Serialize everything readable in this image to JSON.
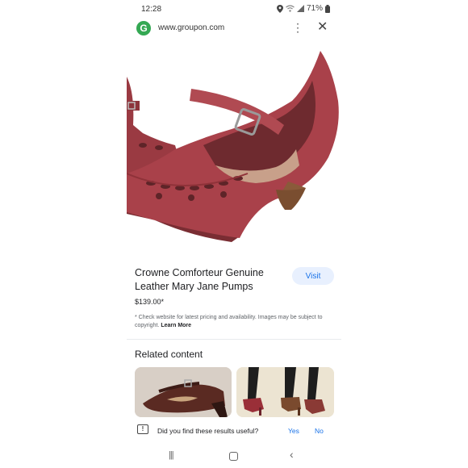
{
  "status_bar": {
    "time": "12:28",
    "battery": "71%",
    "icons": [
      "location-icon",
      "wifi-icon",
      "signal-icon",
      "battery-icon"
    ]
  },
  "browser": {
    "url": "www.groupon.com",
    "favicon_letter": "G",
    "menu_icon": "kebab-menu-icon",
    "close_icon": "close-icon"
  },
  "product": {
    "title": "Crowne Comforteur Genuine Leather Mary Jane Pumps",
    "price": "$139.00*",
    "visit_label": "Visit",
    "disclaimer_text": "* Check website for latest pricing and availability. Images may be subject to copyright.",
    "learn_more": "Learn More"
  },
  "related": {
    "heading": "Related content"
  },
  "feedback": {
    "question": "Did you find these results useful?",
    "yes": "Yes",
    "no": "No"
  },
  "colors": {
    "accent": "#1a73e8",
    "visit_bg": "#e8f0fe",
    "shoe": "#a9414a"
  }
}
